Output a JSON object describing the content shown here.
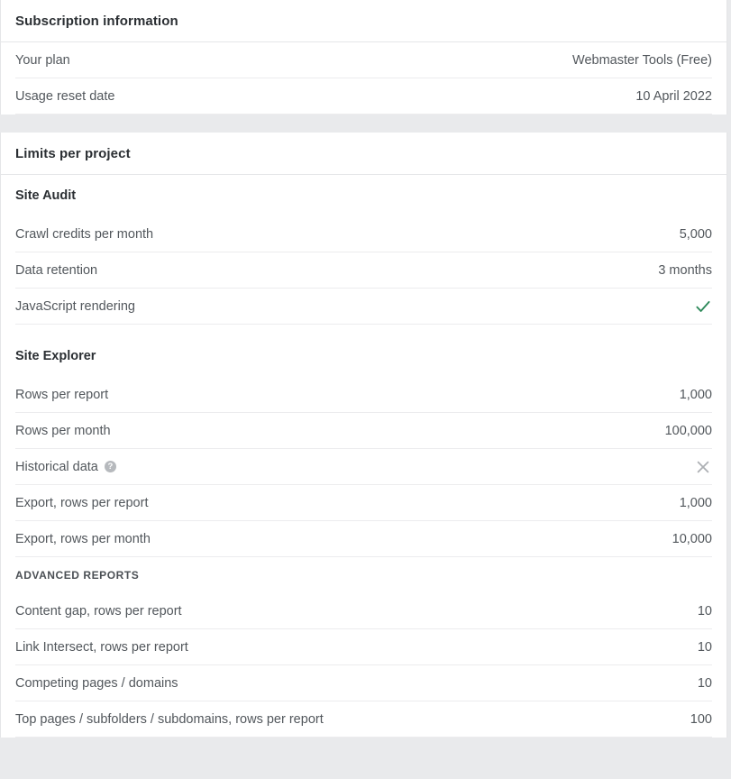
{
  "subscription": {
    "title": "Subscription information",
    "rows": [
      {
        "label": "Your plan",
        "value": "Webmaster Tools (Free)"
      },
      {
        "label": "Usage reset date",
        "value": "10 April 2022"
      }
    ]
  },
  "limits": {
    "title": "Limits per project",
    "groups": [
      {
        "name": "Site Audit",
        "rows": [
          {
            "label": "Crawl credits per month",
            "value": "5,000",
            "type": "text"
          },
          {
            "label": "Data retention",
            "value": "3 months",
            "type": "text"
          },
          {
            "label": "JavaScript rendering",
            "value": "",
            "type": "check",
            "icon": "check-icon"
          }
        ]
      },
      {
        "name": "Site Explorer",
        "rows": [
          {
            "label": "Rows per report",
            "value": "1,000",
            "type": "text"
          },
          {
            "label": "Rows per month",
            "value": "100,000",
            "type": "text"
          },
          {
            "label": "Historical data",
            "value": "",
            "type": "cross",
            "icon": "close-icon",
            "help": "?"
          },
          {
            "label": "Export, rows per report",
            "value": "1,000",
            "type": "text"
          },
          {
            "label": "Export, rows per month",
            "value": "10,000",
            "type": "text"
          }
        ],
        "subgroups": [
          {
            "name": "ADVANCED REPORTS",
            "rows": [
              {
                "label": "Content gap, rows per report",
                "value": "10",
                "type": "text"
              },
              {
                "label": "Link Intersect, rows per report",
                "value": "10",
                "type": "text"
              },
              {
                "label": "Competing pages / domains",
                "value": "10",
                "type": "text"
              },
              {
                "label": "Top pages / subfolders / subdomains, rows per report",
                "value": "100",
                "type": "text"
              }
            ]
          }
        ]
      }
    ]
  },
  "colors": {
    "check": "#2f8a5b",
    "cross": "#adb0b4",
    "text": "#52575c",
    "heading": "#2b2f33",
    "divider": "#ececee",
    "page_bg": "#e9eaec"
  }
}
